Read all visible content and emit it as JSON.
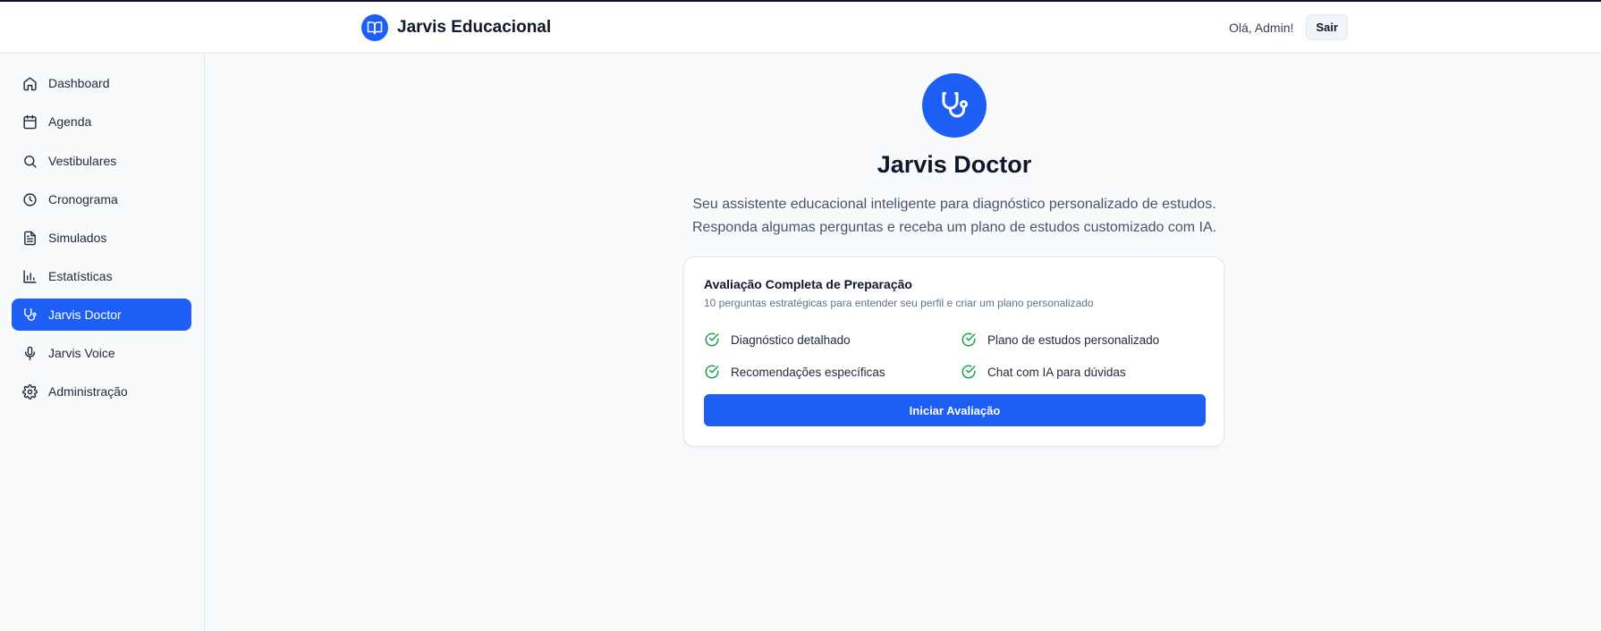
{
  "app": {
    "title": "Jarvis Educacional",
    "logo_icon": "book-open-icon"
  },
  "header": {
    "greeting": "Olá, Admin!",
    "logout_label": "Sair"
  },
  "colors": {
    "accent": "#1d5ff5",
    "success": "#16a34a"
  },
  "sidebar": {
    "items": [
      {
        "label": "Dashboard",
        "icon": "home-icon",
        "active": false
      },
      {
        "label": "Agenda",
        "icon": "calendar-icon",
        "active": false
      },
      {
        "label": "Vestibulares",
        "icon": "search-icon",
        "active": false
      },
      {
        "label": "Cronograma",
        "icon": "clock-icon",
        "active": false
      },
      {
        "label": "Simulados",
        "icon": "document-icon",
        "active": false
      },
      {
        "label": "Estatísticas",
        "icon": "bar-chart-icon",
        "active": false
      },
      {
        "label": "Jarvis Doctor",
        "icon": "stethoscope-icon",
        "active": true
      },
      {
        "label": "Jarvis Voice",
        "icon": "microphone-icon",
        "active": false
      },
      {
        "label": "Administração",
        "icon": "gear-icon",
        "active": false
      }
    ]
  },
  "main": {
    "hero_icon": "stethoscope-icon",
    "title": "Jarvis Doctor",
    "subtitle_line1": "Seu assistente educacional inteligente para diagnóstico personalizado de estudos.",
    "subtitle_line2": "Responda algumas perguntas e receba um plano de estudos customizado com IA.",
    "card": {
      "title": "Avaliação Completa de Preparação",
      "description": "10 perguntas estratégicas para entender seu perfil e criar um plano personalizado",
      "features": [
        "Diagnóstico detalhado",
        "Plano de estudos personalizado",
        "Recomendações específicas",
        "Chat com IA para dúvidas"
      ],
      "button_label": "Iniciar Avaliação"
    }
  }
}
